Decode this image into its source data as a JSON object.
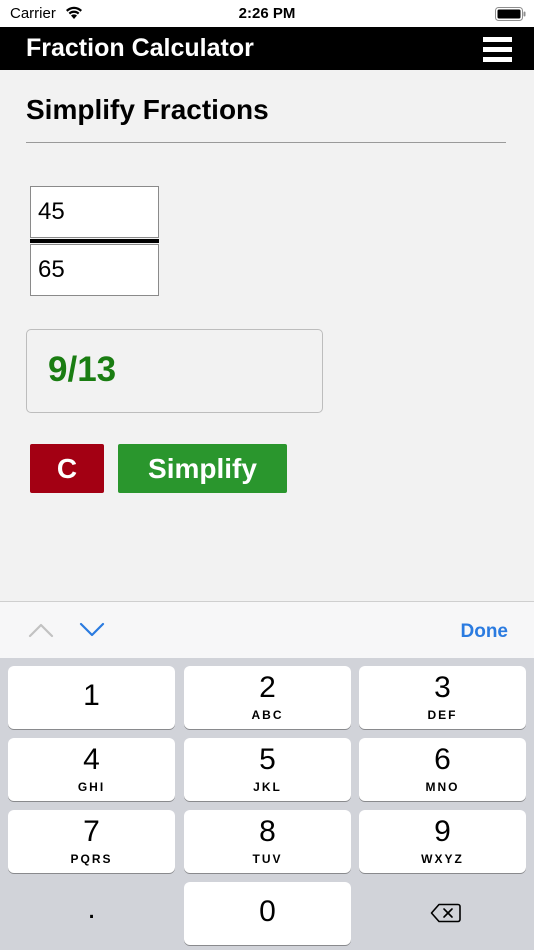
{
  "status_bar": {
    "carrier": "Carrier",
    "time": "2:26 PM"
  },
  "header": {
    "title": "Fraction Calculator",
    "menu_icon": "hamburger-menu-icon"
  },
  "main": {
    "page_title": "Simplify Fractions",
    "numerator": "45",
    "denominator": "65",
    "result": "9/13",
    "clear_label": "C",
    "simplify_label": "Simplify"
  },
  "accessory_bar": {
    "prev_icon": "chevron-up-icon",
    "next_icon": "chevron-down-icon",
    "done_label": "Done"
  },
  "keyboard": {
    "keys": [
      {
        "digit": "1",
        "letters": ""
      },
      {
        "digit": "2",
        "letters": "ABC"
      },
      {
        "digit": "3",
        "letters": "DEF"
      },
      {
        "digit": "4",
        "letters": "GHI"
      },
      {
        "digit": "5",
        "letters": "JKL"
      },
      {
        "digit": "6",
        "letters": "MNO"
      },
      {
        "digit": "7",
        "letters": "PQRS"
      },
      {
        "digit": "8",
        "letters": "TUV"
      },
      {
        "digit": "9",
        "letters": "WXYZ"
      }
    ],
    "decimal": ".",
    "zero": "0",
    "delete_icon": "backspace-icon"
  },
  "colors": {
    "header_bg": "#000000",
    "result_text": "#1a7d12",
    "clear_button": "#a30013",
    "simplify_button": "#2a962d",
    "done_link": "#2b7be0"
  }
}
